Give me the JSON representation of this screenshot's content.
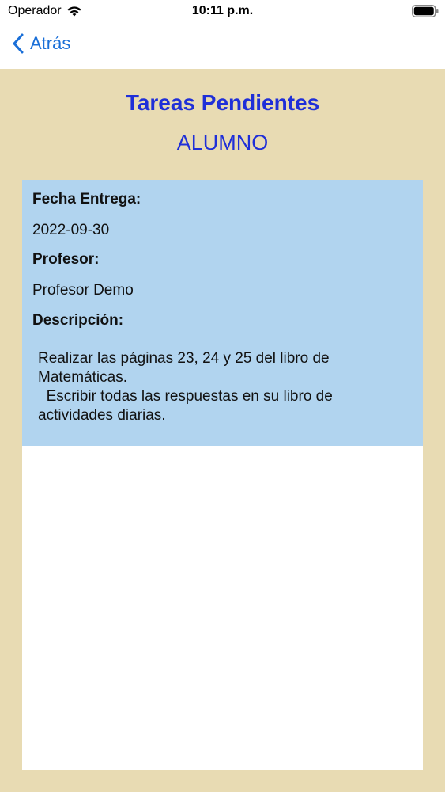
{
  "status_bar": {
    "carrier": "Operador",
    "time": "10:11 p.m."
  },
  "nav": {
    "back_label": "Atrás"
  },
  "header": {
    "title": "Tareas Pendientes",
    "subtitle": "ALUMNO"
  },
  "task": {
    "due_date_label": "Fecha Entrega:",
    "due_date": "2022-09-30",
    "teacher_label": "Profesor:",
    "teacher": "Profesor Demo",
    "description_label": "Descripción:",
    "description": "Realizar las páginas 23, 24 y 25 del libro de Matemáticas.\n  Escribir todas las respuestas en su libro de actividades diarias."
  },
  "colors": {
    "background": "#e8dbb3",
    "title": "#1f2fd8",
    "back_link": "#1a6fd8",
    "card_info": "#b1d4ef",
    "card": "#ffffff"
  },
  "icons": {
    "wifi": "wifi-icon",
    "battery": "battery-icon",
    "back": "chevron-left-icon"
  }
}
